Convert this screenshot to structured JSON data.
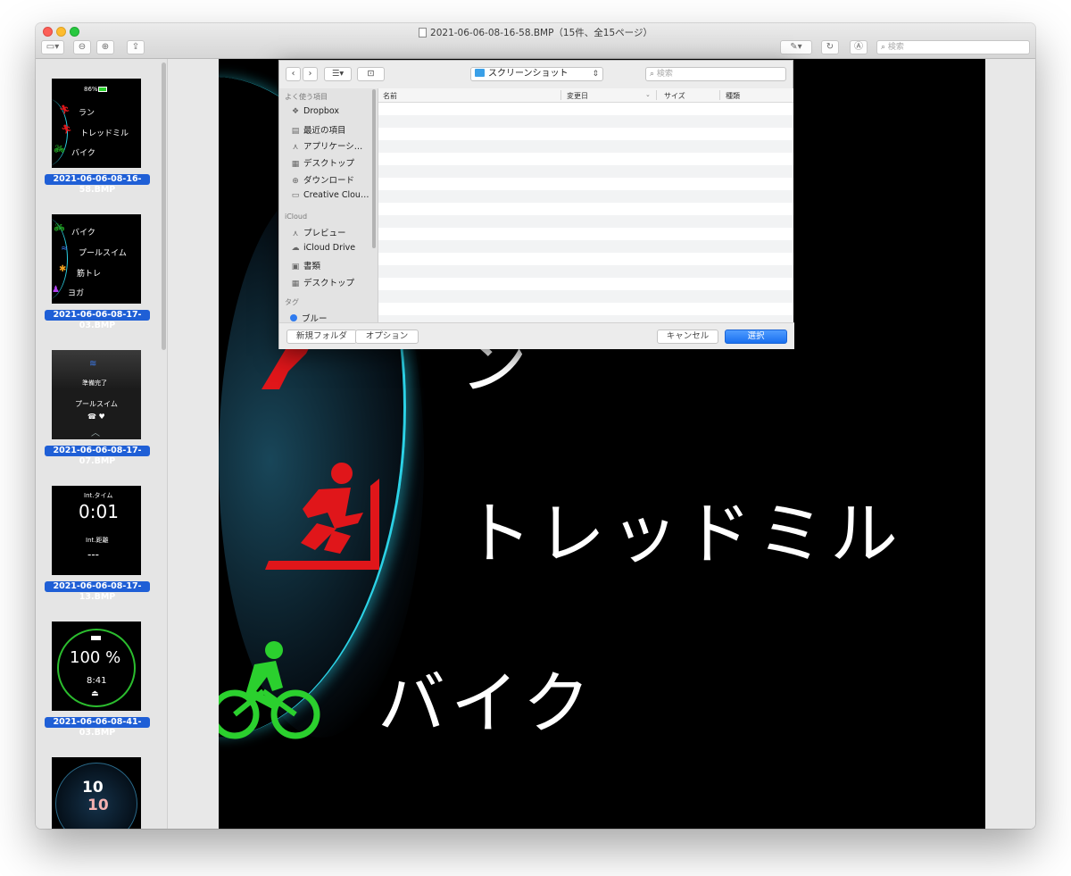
{
  "window": {
    "title": "2021-06-06-08-16-58.BMP（15件、全15ページ）",
    "search_placeholder": "検索"
  },
  "sidebar": {
    "items": [
      {
        "caption": "2021-06-06-08-16-58.BMP",
        "battery": "86%",
        "labels": [
          "ラン",
          "トレッドミル",
          "バイク"
        ]
      },
      {
        "caption": "2021-06-06-08-17-03.BMP",
        "labels": [
          "バイク",
          "プールスイム",
          "筋トレ",
          "ヨガ"
        ]
      },
      {
        "caption": "2021-06-06-08-17-07.BMP",
        "status": "準備完了",
        "mode": "プールスイム"
      },
      {
        "caption": "2021-06-06-08-17-13.BMP",
        "top_label": "Int.タイム",
        "time": "0:01",
        "bottom_label": "Int.距離",
        "distance": "---"
      },
      {
        "caption": "2021-06-06-08-41-03.BMP",
        "percent": "100 %",
        "clock": "8:41"
      },
      {
        "caption": "",
        "clock_hour": "10",
        "clock_min": "10"
      }
    ]
  },
  "preview": {
    "labels": [
      "トレッドミル",
      "バイク"
    ],
    "partial_label": "ン"
  },
  "dialog": {
    "location": "スクリーンショット",
    "search_placeholder": "検索",
    "sections": {
      "favorites": "よく使う項目",
      "icloud": "iCloud",
      "tags": "タグ"
    },
    "favorites": [
      "Dropbox",
      "最近の項目",
      "アプリケーシ…",
      "デスクトップ",
      "ダウンロード",
      "Creative Clou…"
    ],
    "icloud_items": [
      "プレビュー",
      "iCloud Drive",
      "書類",
      "デスクトップ"
    ],
    "tags": [
      "ブルー"
    ],
    "columns": {
      "name": "名前",
      "modified": "変更日",
      "size": "サイズ",
      "kind": "種類"
    },
    "buttons": {
      "new_folder": "新規フォルダ",
      "options": "オプション",
      "cancel": "キャンセル",
      "choose": "選択"
    }
  },
  "colors": {
    "accent": "#1f5fd6",
    "primary_button": "#1a70f0",
    "run_icon": "#e0161a",
    "bike_icon": "#2bd02e",
    "arc": "#2cd2e6"
  }
}
